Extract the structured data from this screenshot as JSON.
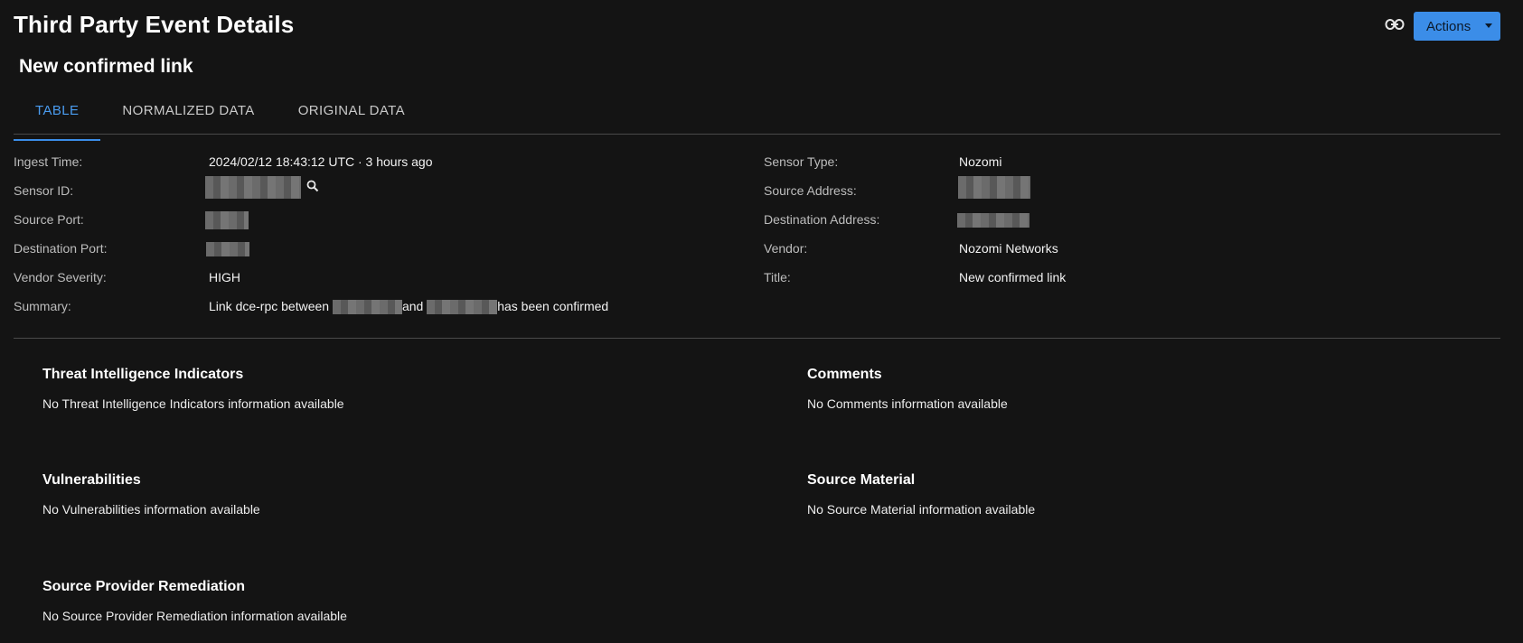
{
  "header": {
    "title": "Third Party Event Details",
    "actions_label": "Actions",
    "link_icon": "link-icon",
    "accent_color": "#3b8de8"
  },
  "event": {
    "title": "New confirmed link"
  },
  "tabs": [
    {
      "label": "TABLE",
      "active": true
    },
    {
      "label": "NORMALIZED DATA",
      "active": false
    },
    {
      "label": "ORIGINAL DATA",
      "active": false
    }
  ],
  "details": {
    "ingest_time": {
      "label": "Ingest Time:",
      "value": "2024/02/12 18:43:12 UTC · 3 hours ago"
    },
    "sensor_id": {
      "label": "Sensor ID:",
      "value": "",
      "icon": "search-icon"
    },
    "source_port": {
      "label": "Source Port:",
      "value": ""
    },
    "destination_port": {
      "label": "Destination Port:",
      "value": ""
    },
    "vendor_severity": {
      "label": "Vendor Severity:",
      "value": "HIGH"
    },
    "summary": {
      "label": "Summary:",
      "prefix": "Link dce-rpc between",
      "middle": "and",
      "suffix": "has been confirmed"
    },
    "sensor_type": {
      "label": "Sensor Type:",
      "value": "Nozomi"
    },
    "source_address": {
      "label": "Source Address:",
      "value": ""
    },
    "destination_address": {
      "label": "Destination Address:",
      "value": ""
    },
    "vendor": {
      "label": "Vendor:",
      "value": "Nozomi Networks"
    },
    "title": {
      "label": "Title:",
      "value": "New confirmed link"
    }
  },
  "sections": {
    "threat_intel": {
      "title": "Threat Intelligence Indicators",
      "empty": "No Threat Intelligence Indicators information available"
    },
    "comments": {
      "title": "Comments",
      "empty": "No Comments information available"
    },
    "vulnerabilities": {
      "title": "Vulnerabilities",
      "empty": "No Vulnerabilities information available"
    },
    "source_material": {
      "title": "Source Material",
      "empty": "No Source Material information available"
    },
    "remediation": {
      "title": "Source Provider Remediation",
      "empty": "No Source Provider Remediation information available"
    }
  }
}
